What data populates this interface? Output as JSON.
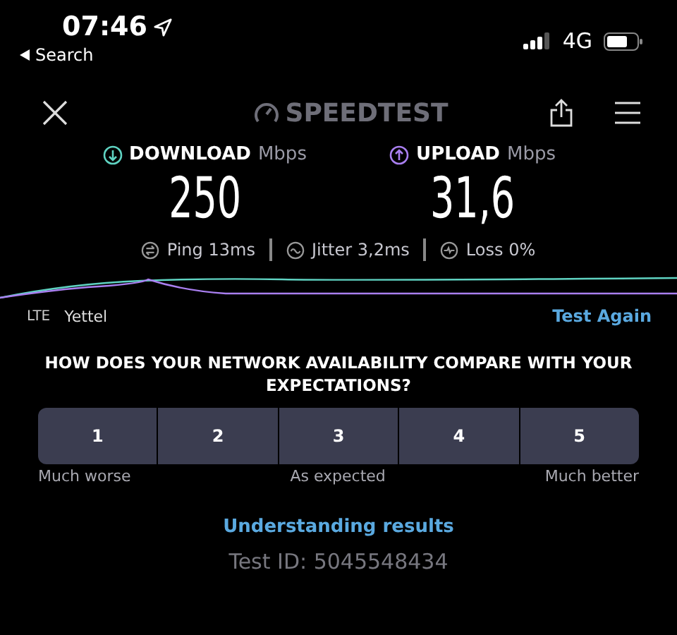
{
  "status_bar": {
    "time": "07:46",
    "back": "Search",
    "network": "4G"
  },
  "header": {
    "logo": "SPEEDTEST"
  },
  "results": [
    {
      "kind": "download",
      "label": "DOWNLOAD",
      "unit": "Mbps",
      "value": "250"
    },
    {
      "kind": "upload",
      "label": "UPLOAD",
      "unit": "Mbps",
      "value": "31,6"
    }
  ],
  "stats": [
    {
      "kind": "ping",
      "label": "Ping",
      "value": "13ms"
    },
    {
      "kind": "jitter",
      "label": "Jitter",
      "value": "3,2ms"
    },
    {
      "kind": "loss",
      "label": "Loss",
      "value": "0%"
    }
  ],
  "connection": {
    "type": "LTE",
    "provider": "Yettel",
    "action": "Test Again"
  },
  "survey": {
    "question": "HOW DOES YOUR NETWORK AVAILABILITY COMPARE WITH YOUR EXPECTATIONS?",
    "options": [
      {
        "label": "1",
        "selected": false
      },
      {
        "label": "2",
        "selected": false
      },
      {
        "label": "3",
        "selected": false
      },
      {
        "label": "4",
        "selected": false
      },
      {
        "label": "5",
        "selected": false
      }
    ],
    "scale": [
      "Much worse",
      "As expected",
      "Much better"
    ]
  },
  "link": "Understanding results",
  "test_id": "Test ID: 5045548434"
}
